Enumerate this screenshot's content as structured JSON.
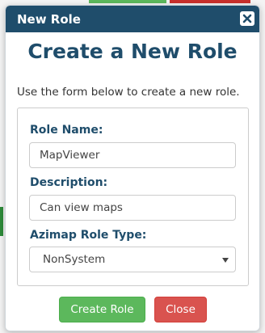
{
  "dialog": {
    "title": "New Role",
    "heading": "Create a New Role",
    "intro": "Use the form below to create a new role."
  },
  "form": {
    "role_name_label": "Role Name:",
    "role_name_value": "MapViewer",
    "description_label": "Description:",
    "description_value": "Can view maps",
    "role_type_label": "Azimap Role Type:",
    "role_type_value": "NonSystem"
  },
  "buttons": {
    "create_label": "Create Role",
    "close_label": "Close"
  },
  "colors": {
    "titlebar": "#1f4d6b",
    "heading": "#1f4d6b",
    "create_button": "#5cb85c",
    "close_button": "#d9534f"
  },
  "icons": {
    "close": "close-icon",
    "dropdown": "chevron-down-icon"
  }
}
